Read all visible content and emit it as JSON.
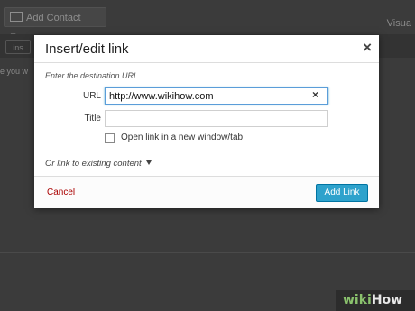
{
  "background": {
    "toolbar_button": "Add Contact Form",
    "visual_tab": "Visua",
    "ins_button": "ins",
    "text_fragment": "e  you  w"
  },
  "dialog": {
    "title": "Insert/edit link",
    "close_symbol": "×",
    "hint": "Enter the destination URL",
    "url_label": "URL",
    "url_value": "http://www.wikihow.com",
    "clear_symbol": "×",
    "title_label": "Title",
    "title_value": "",
    "new_window_label": "Open link in a new window/tab",
    "existing_content": "Or link to existing content",
    "cancel": "Cancel",
    "add_link": "Add Link"
  },
  "watermark": {
    "wiki": "wiki",
    "how": "How"
  }
}
